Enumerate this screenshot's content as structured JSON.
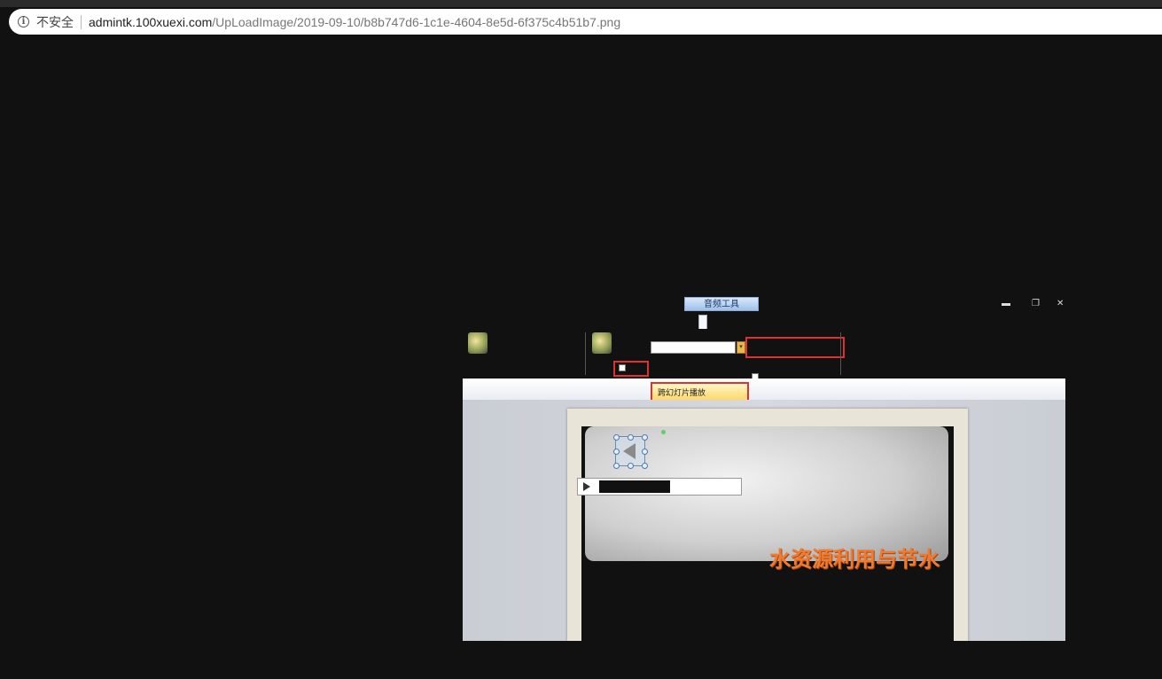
{
  "browser": {
    "security_label": "不安全",
    "url_host": "admintk.100xuexi.com",
    "url_path": "/UpLoadImage/2019-09-10/b8b747d6-1c1e-4604-8e5d-6f375c4b51b7.png"
  },
  "screenshot": {
    "audio_tools_tab": "音频工具",
    "playback_option": "跨幻灯片播放",
    "slide_title": "水资源利用与节水",
    "colors": {
      "background": "#111111",
      "highlight_box": "#e03030",
      "slide_title": "#f07a30"
    }
  }
}
